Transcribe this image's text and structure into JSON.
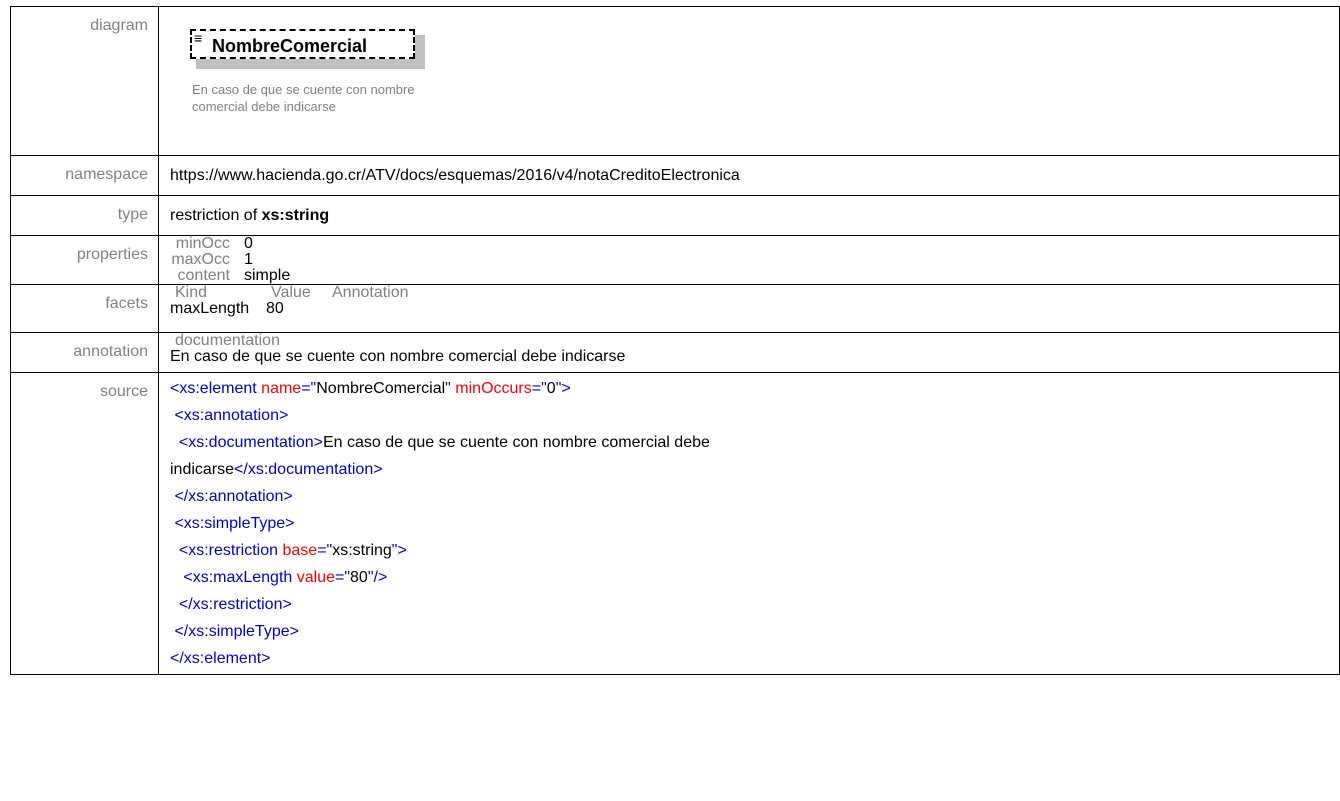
{
  "rows": {
    "diagram": {
      "label": "diagram",
      "element_name": "NombreComercial",
      "element_doc": "En caso de que se cuente con nombre comercial debe indicarse"
    },
    "namespace": {
      "label": "namespace",
      "value": "https://www.hacienda.go.cr/ATV/docs/esquemas/2016/v4/notaCreditoElectronica"
    },
    "type": {
      "label": "type",
      "prefix": "restriction of ",
      "base": "xs:string"
    },
    "properties": {
      "label": "properties",
      "items": [
        {
          "key": "minOcc",
          "value": "0"
        },
        {
          "key": "maxOcc",
          "value": "1"
        },
        {
          "key": "content",
          "value": "simple"
        }
      ]
    },
    "facets": {
      "label": "facets",
      "headers": [
        "Kind",
        "Value",
        "Annotation"
      ],
      "rows": [
        {
          "kind": "maxLength",
          "value": "80",
          "annotation": ""
        }
      ]
    },
    "annotation": {
      "label": "annotation",
      "head": "documentation",
      "text": "En caso de que se cuente con nombre comercial debe indicarse"
    },
    "source": {
      "label": "source",
      "lines": [
        "<xs:element name=\"NombreComercial\" minOccurs=\"0\">",
        " <xs:annotation>",
        "  <xs:documentation>En caso de que se cuente con nombre comercial debe",
        "indicarse</xs:documentation>",
        " </xs:annotation>",
        " <xs:simpleType>",
        "  <xs:restriction base=\"xs:string\">",
        "   <xs:maxLength value=\"80\"/>",
        "  </xs:restriction>",
        " </xs:simpleType>",
        "</xs:element>"
      ]
    }
  },
  "icons": {
    "element_icon": "element-list-icon"
  },
  "colors": {
    "label_gray": "#808080",
    "tag_blue": "#0000cc",
    "attr_red": "#ff0000",
    "shadow_gray": "#c0c0c0"
  }
}
